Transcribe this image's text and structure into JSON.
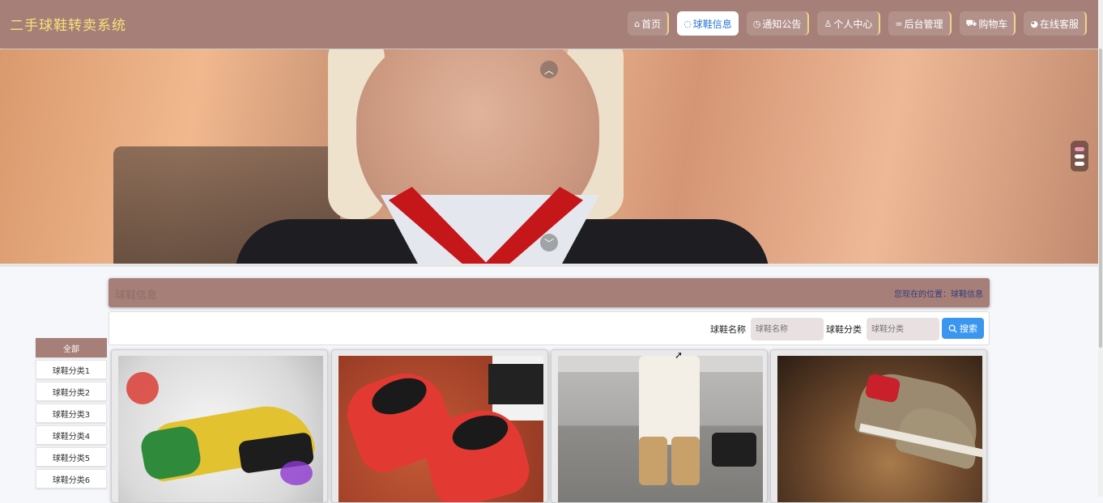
{
  "header": {
    "site_title": "二手球鞋转卖系统",
    "nav": [
      {
        "icon": "home-icon",
        "glyph": "⌂",
        "label": "首页",
        "active": false
      },
      {
        "icon": "shoe-info-icon",
        "glyph": "◌",
        "label": "球鞋信息",
        "active": true
      },
      {
        "icon": "notice-icon",
        "glyph": "◷",
        "label": "通知公告",
        "active": false
      },
      {
        "icon": "user-icon",
        "glyph": "♙",
        "label": "个人中心",
        "active": false
      },
      {
        "icon": "link-icon",
        "glyph": "∞",
        "label": "后台管理",
        "active": false
      },
      {
        "icon": "cart-icon",
        "glyph": "⛟",
        "label": "购物车",
        "active": false
      },
      {
        "icon": "service-icon",
        "glyph": "◕",
        "label": "在线客服",
        "active": false
      }
    ]
  },
  "banner": {
    "prev_glyph": "︿",
    "next_glyph": "﹀",
    "slide_count": 3,
    "active_slide": 1
  },
  "section": {
    "title": "球鞋信息",
    "breadcrumb": "您现在的位置：球鞋信息"
  },
  "search": {
    "name_label": "球鞋名称",
    "name_placeholder": "球鞋名称",
    "category_label": "球鞋分类",
    "category_placeholder": "球鞋分类",
    "button_label": "搜索",
    "button_icon": "search-icon"
  },
  "sidebar": {
    "items": [
      {
        "label": "全部",
        "active": true
      },
      {
        "label": "球鞋分类1",
        "active": false
      },
      {
        "label": "球鞋分类2",
        "active": false
      },
      {
        "label": "球鞋分类3",
        "active": false
      },
      {
        "label": "球鞋分类4",
        "active": false
      },
      {
        "label": "球鞋分类5",
        "active": false
      },
      {
        "label": "球鞋分类6",
        "active": false
      }
    ]
  },
  "colors": {
    "header_bg": "#a67f78",
    "title_color": "#f6e27a",
    "active_nav_text": "#2a78d6",
    "search_button": "#3b96f0",
    "active_dot": "#f39ac1"
  }
}
